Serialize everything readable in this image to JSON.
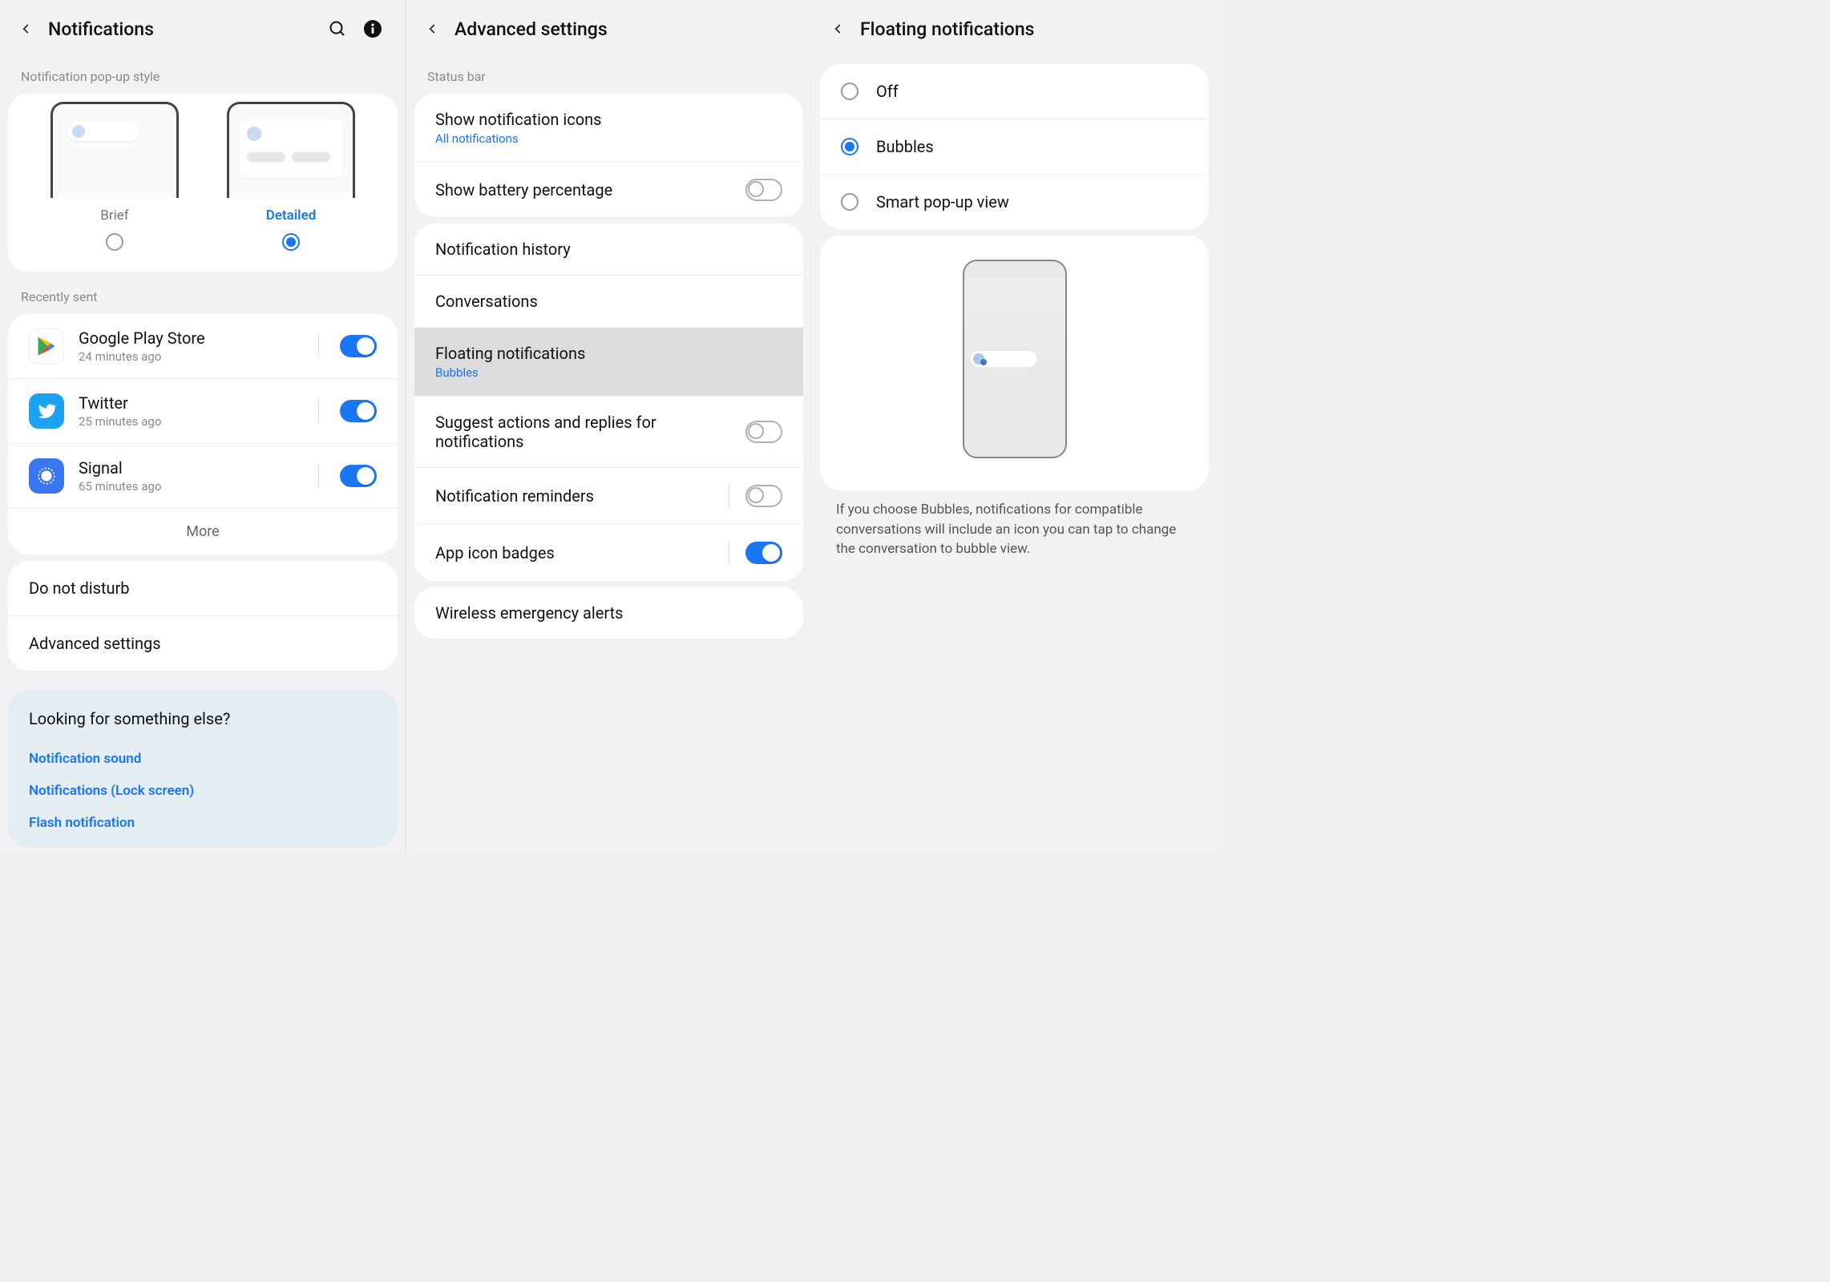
{
  "colors": {
    "accent": "#1976f5"
  },
  "panel1": {
    "title": "Notifications",
    "popup_section_label": "Notification pop-up style",
    "popup_options": {
      "brief": "Brief",
      "detailed": "Detailed"
    },
    "popup_selected": "detailed",
    "recent_label": "Recently sent",
    "apps": [
      {
        "name": "Google Play Store",
        "sub": "24 minutes ago",
        "icon": "play",
        "on": true
      },
      {
        "name": "Twitter",
        "sub": "25 minutes ago",
        "icon": "twitter",
        "on": true
      },
      {
        "name": "Signal",
        "sub": "65 minutes ago",
        "icon": "signal",
        "on": true
      }
    ],
    "more_label": "More",
    "extra": {
      "dnd": "Do not disturb",
      "advanced": "Advanced settings"
    },
    "suggest": {
      "title": "Looking for something else?",
      "links": [
        "Notification sound",
        "Notifications (Lock screen)",
        "Flash notification"
      ]
    }
  },
  "panel2": {
    "title": "Advanced settings",
    "status_bar_label": "Status bar",
    "rows": {
      "show_icons": {
        "title": "Show notification icons",
        "sub": "All notifications"
      },
      "battery": {
        "title": "Show battery percentage",
        "on": false
      },
      "history": "Notification history",
      "conversations": "Conversations",
      "floating": {
        "title": "Floating notifications",
        "sub": "Bubbles"
      },
      "suggest": {
        "title": "Suggest actions and replies for notifications",
        "on": false
      },
      "reminders": {
        "title": "Notification reminders",
        "on": false
      },
      "badges": {
        "title": "App icon badges",
        "on": true
      },
      "emergency": "Wireless emergency alerts"
    }
  },
  "panel3": {
    "title": "Floating notifications",
    "options": {
      "off": "Off",
      "bubbles": "Bubbles",
      "smart": "Smart pop-up view"
    },
    "selected": "bubbles",
    "description": "If you choose Bubbles, notifications for compatible conversations will include an icon you can tap to change the conversation to bubble view."
  }
}
